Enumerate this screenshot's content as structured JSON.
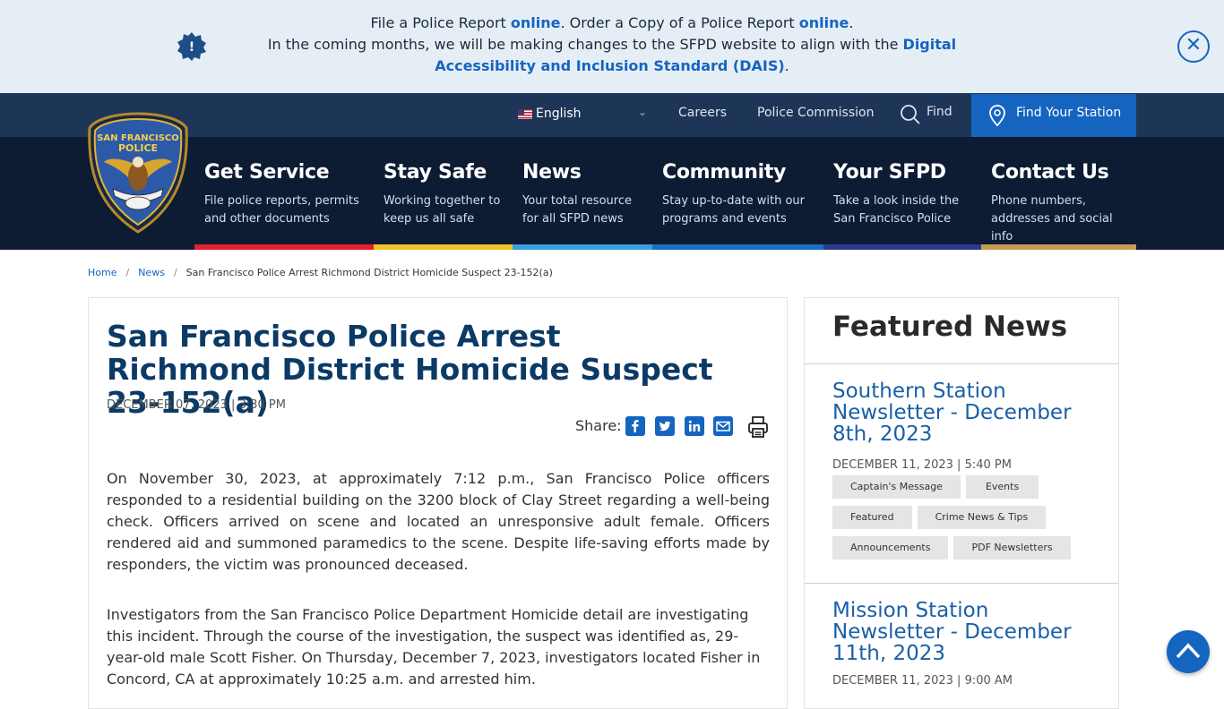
{
  "alert": {
    "line1_a": "File a Police Report ",
    "line1_link1": "online",
    "line1_b": ". Order a Copy of a Police Report ",
    "line1_link2": "online",
    "line1_c": ".",
    "line2_a": "In the coming months, we will be making changes to the SFPD website to align with the ",
    "line2_link": "Digital Accessibility and Inclusion Standard (DAIS)",
    "line2_b": ".",
    "close_symbol": "✕",
    "badge_symbol": "!"
  },
  "utility": {
    "language": "English",
    "links": [
      "Careers",
      "Police Commission"
    ],
    "find": "Find",
    "find_station": "Find Your Station"
  },
  "logo": {
    "top": "SAN FRANCISCO",
    "middle": "POLICE"
  },
  "nav": [
    {
      "title": "Get Service",
      "sub1": "File police reports, permits",
      "sub2": "and other documents",
      "color": "#e3202c"
    },
    {
      "title": "Stay Safe",
      "sub1": "Working together to",
      "sub2": "keep us all safe",
      "color": "#f0c224"
    },
    {
      "title": "News",
      "sub1": "Your total resource",
      "sub2": "for all SFPD news",
      "color": "#3a9fe0"
    },
    {
      "title": "Community",
      "sub1": "Stay up-to-date with our",
      "sub2": "programs and events",
      "color": "#1b6fc2"
    },
    {
      "title": "Your SFPD",
      "sub1": "Take a look inside the",
      "sub2": "San Francisco Police",
      "color": "#2a3a8f"
    },
    {
      "title": "Contact Us",
      "sub1": "Phone numbers,",
      "sub2": "addresses and social info",
      "color": "#c79a52"
    }
  ],
  "breadcrumb": [
    "Home",
    "News",
    "San Francisco Police Arrest Richmond District Homicide Suspect 23-152(a)"
  ],
  "article": {
    "title": "San Francisco Police Arrest Richmond District Homicide Suspect 23-152(a)",
    "date": "DECEMBER 07, 2023 | 3:30 PM",
    "share_label": "Share:",
    "p1": "On November 30, 2023, at approximately 7:12 p.m., San Francisco Police officers responded to a residential building on the 3200 block of Clay Street regarding a well-being check. Officers arrived on scene and located an unresponsive adult female. Officers rendered aid and summoned paramedics to the scene.  Despite life-saving efforts made by responders, the victim was pronounced deceased.",
    "p2": "Investigators from the San Francisco Police Department Homicide detail are investigating this incident. Through the course of the investigation, the suspect was identified as, 29-year-old male Scott Fisher. On Thursday, December 7, 2023, investigators located Fisher in Concord, CA at approximately 10:25 a.m. and arrested him."
  },
  "sidebar": {
    "heading": "Featured News",
    "posts": [
      {
        "title": "Southern Station Newsletter - December 8th, 2023",
        "date": "DECEMBER 11, 2023 | 5:40 PM",
        "tags": [
          "Captain's Message",
          "Events",
          "Featured",
          "Crime News & Tips",
          "Announcements",
          "PDF Newsletters"
        ]
      },
      {
        "title": "Mission Station Newsletter - December 11th, 2023",
        "date": "DECEMBER 11, 2023 | 9:00 AM"
      }
    ]
  }
}
